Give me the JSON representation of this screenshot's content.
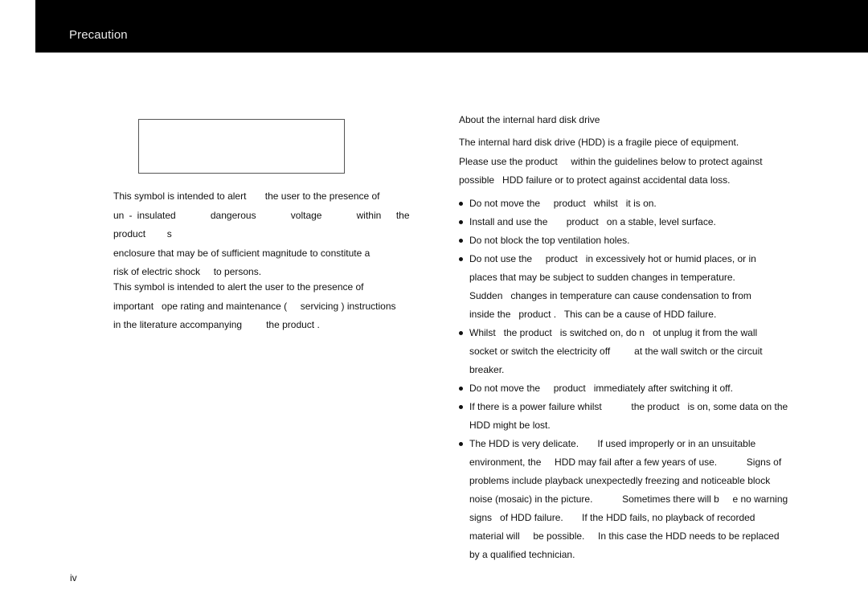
{
  "header": {
    "title": "Precaution"
  },
  "symbols": {
    "box_label": "symbol-placeholder",
    "electric_shock": {
      "text": "This symbol is intended to alert the user to the presence of un-insulated dangerous voltage within the product's enclosure that may be of sufficient magnitude to constitute a risk of electric shock to persons.",
      "lines": [
        "This symbol is intended to alert       the user to the presence of",
        "un - insulated       dangerous       voltage       within   the   product     s",
        "enclosure that may be of sufficient magnitude to constitute a",
        "risk of electric shock     to persons."
      ]
    },
    "instructions": {
      "text": "This symbol is intended to alert the user to the presence of important operating and maintenance (servicing) instructions in the literature accompanying the product.",
      "lines": [
        "This symbol is intended to alert the user to the presence of",
        "important   ope rating and maintenance (     servicing ) instructions",
        "in the literature accompanying         the product ."
      ]
    }
  },
  "hdd_section": {
    "title": "About the internal hard disk drive",
    "intro_lines": [
      "The internal hard disk drive (HDD) is a fragile piece of equipment.",
      "Please use the product     within the guidelines below to protect against",
      "possible   HDD failure or to protect against accidental data loss."
    ],
    "bullets": [
      {
        "lines": [
          "Do not move the     product   whilst   it is on."
        ]
      },
      {
        "lines": [
          "Install and use the       product   on a stable, level surface."
        ]
      },
      {
        "lines": [
          "Do not block the top ventilation holes."
        ]
      },
      {
        "lines": [
          "Do not use the     product   in excessively hot or humid places, or in",
          "places that may be subject to sudden changes in temperature.",
          "Sudden   changes in temperature can cause condensation to from",
          "inside the   product .   This can be a cause of HDD failure."
        ]
      },
      {
        "lines": [
          "Whilst   the product   is switched on, do n   ot unplug it from the wall",
          "socket or switch the electricity off         at the wall switch or the circuit",
          "breaker."
        ]
      },
      {
        "lines": [
          "Do not move the     product   immediately after switching it off."
        ]
      },
      {
        "lines": [
          "If there is a power failure whilst           the product   is on, some data on the",
          "HDD might be lost."
        ]
      },
      {
        "lines": [
          "The HDD is very delicate.       If used improperly or in an unsuitable",
          "environment, the     HDD may fail after a few years of use.           Signs of",
          "problems include playback unexpectedly freezing and noticeable block",
          "noise (mosaic) in the picture.           Sometimes there will b     e no warning",
          "signs   of HDD failure.       If the HDD fails, no playback of recorded",
          "material will     be possible.     In this case the HDD needs to be replaced",
          "by a qualified technician."
        ]
      }
    ]
  },
  "footer": {
    "page_number": "iv"
  }
}
